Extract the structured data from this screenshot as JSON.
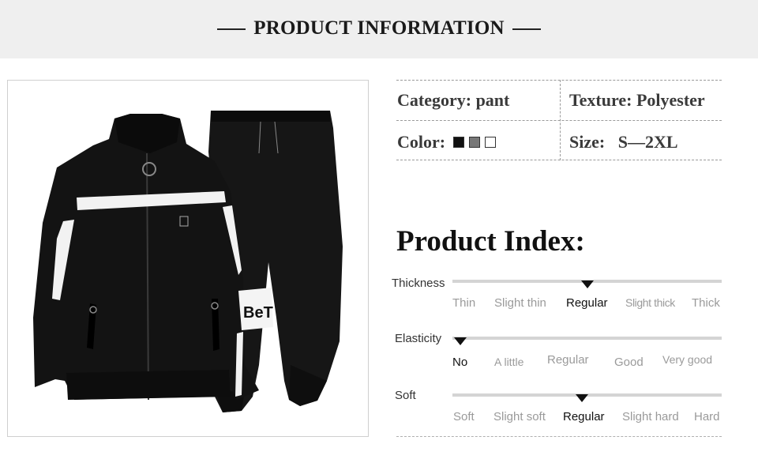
{
  "header": {
    "title": "PRODUCT INFORMATION"
  },
  "attributes": {
    "category": "Category: pant",
    "texture": "Texture: Polyester",
    "color_label": "Color:",
    "size": "Size:   S—2XL",
    "swatches": [
      "#111111",
      "#777777",
      "#ffffff"
    ]
  },
  "index": {
    "title": "Product Index:",
    "scales": [
      {
        "label": "Thickness",
        "options": [
          "Thin",
          "Slight thin",
          "Regular",
          "Slight thick",
          "Thick"
        ],
        "selected": 2
      },
      {
        "label": "Elasticity",
        "options": [
          "No",
          "A little",
          "Regular",
          "Good",
          "Very good"
        ],
        "selected": 0
      },
      {
        "label": "Soft",
        "options": [
          "Soft",
          "Slight soft",
          "Regular",
          "Slight hard",
          "Hard"
        ],
        "selected": 2
      }
    ]
  },
  "product_image": {
    "alt": ""
  }
}
